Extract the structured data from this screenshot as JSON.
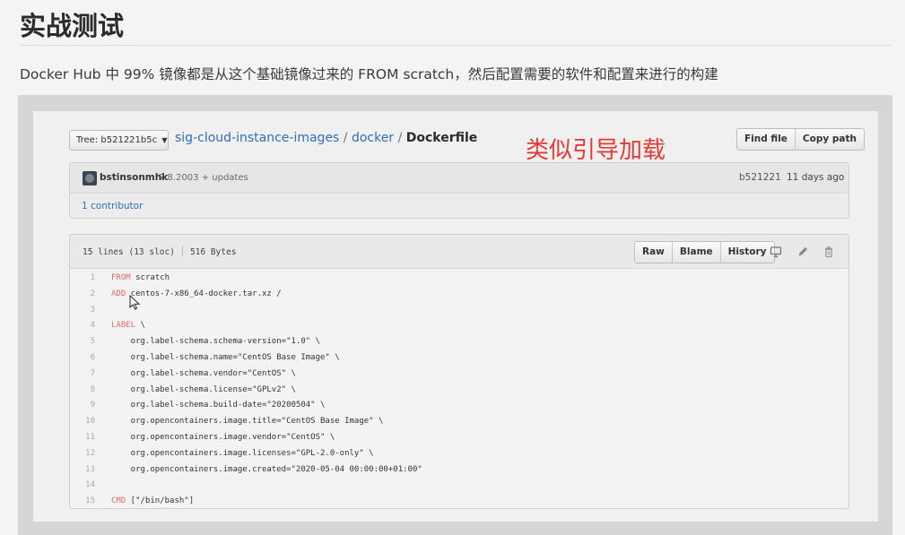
{
  "page": {
    "title": "实战测试",
    "intro": "Docker Hub 中 99% 镜像都是从这个基础镜像过来的 FROM scratch，然后配置需要的软件和配置来进行的构建"
  },
  "annotation": "类似引导加载",
  "repo": {
    "tree_label": "Tree: b521221b5c",
    "breadcrumb": {
      "repo": "sig-cloud-instance-images",
      "sep1": " / ",
      "folder": "docker",
      "sep2": " / ",
      "file": "Dockerfile"
    },
    "find_file": "Find file",
    "copy_path": "Copy path"
  },
  "commit": {
    "author": "bstinsonmhk",
    "message": "7.8.2003 + updates",
    "sha": "b521221",
    "age": "11 days ago",
    "contributors": "1 contributor"
  },
  "file": {
    "lines_info": "15 lines (13 sloc)",
    "size": "516 Bytes",
    "raw": "Raw",
    "blame": "Blame",
    "history": "History",
    "lines": [
      {
        "n": "1",
        "kw": "FROM",
        "rest": " scratch"
      },
      {
        "n": "2",
        "kw": "ADD",
        "rest": " centos-7-x86_64-docker.tar.xz /"
      },
      {
        "n": "3",
        "kw": "",
        "rest": ""
      },
      {
        "n": "4",
        "kw": "LABEL",
        "rest": " \\"
      },
      {
        "n": "5",
        "kw": "",
        "rest": "    org.label-schema.schema-version=\"1.0\" \\"
      },
      {
        "n": "6",
        "kw": "",
        "rest": "    org.label-schema.name=\"CentOS Base Image\" \\"
      },
      {
        "n": "7",
        "kw": "",
        "rest": "    org.label-schema.vendor=\"CentOS\" \\"
      },
      {
        "n": "8",
        "kw": "",
        "rest": "    org.label-schema.license=\"GPLv2\" \\"
      },
      {
        "n": "9",
        "kw": "",
        "rest": "    org.label-schema.build-date=\"20200504\" \\"
      },
      {
        "n": "10",
        "kw": "",
        "rest": "    org.opencontainers.image.title=\"CentOS Base Image\" \\"
      },
      {
        "n": "11",
        "kw": "",
        "rest": "    org.opencontainers.image.vendor=\"CentOS\" \\"
      },
      {
        "n": "12",
        "kw": "",
        "rest": "    org.opencontainers.image.licenses=\"GPL-2.0-only\" \\"
      },
      {
        "n": "13",
        "kw": "",
        "rest": "    org.opencontainers.image.created=\"2020-05-04 00:00:00+01:00\""
      },
      {
        "n": "14",
        "kw": "",
        "rest": ""
      },
      {
        "n": "15",
        "kw": "CMD",
        "rest": " [\"/bin/bash\"]"
      }
    ]
  },
  "icons": {
    "tree_chevron": "caret-down-icon",
    "desktop": "desktop-icon",
    "edit": "pencil-icon",
    "delete": "trash-icon",
    "pointer": "mouse-pointer-icon",
    "avatar": "avatar-image"
  },
  "colors": {
    "link": "#2f6fb7",
    "annotation": "#e53935",
    "keyword": "#d77060"
  }
}
